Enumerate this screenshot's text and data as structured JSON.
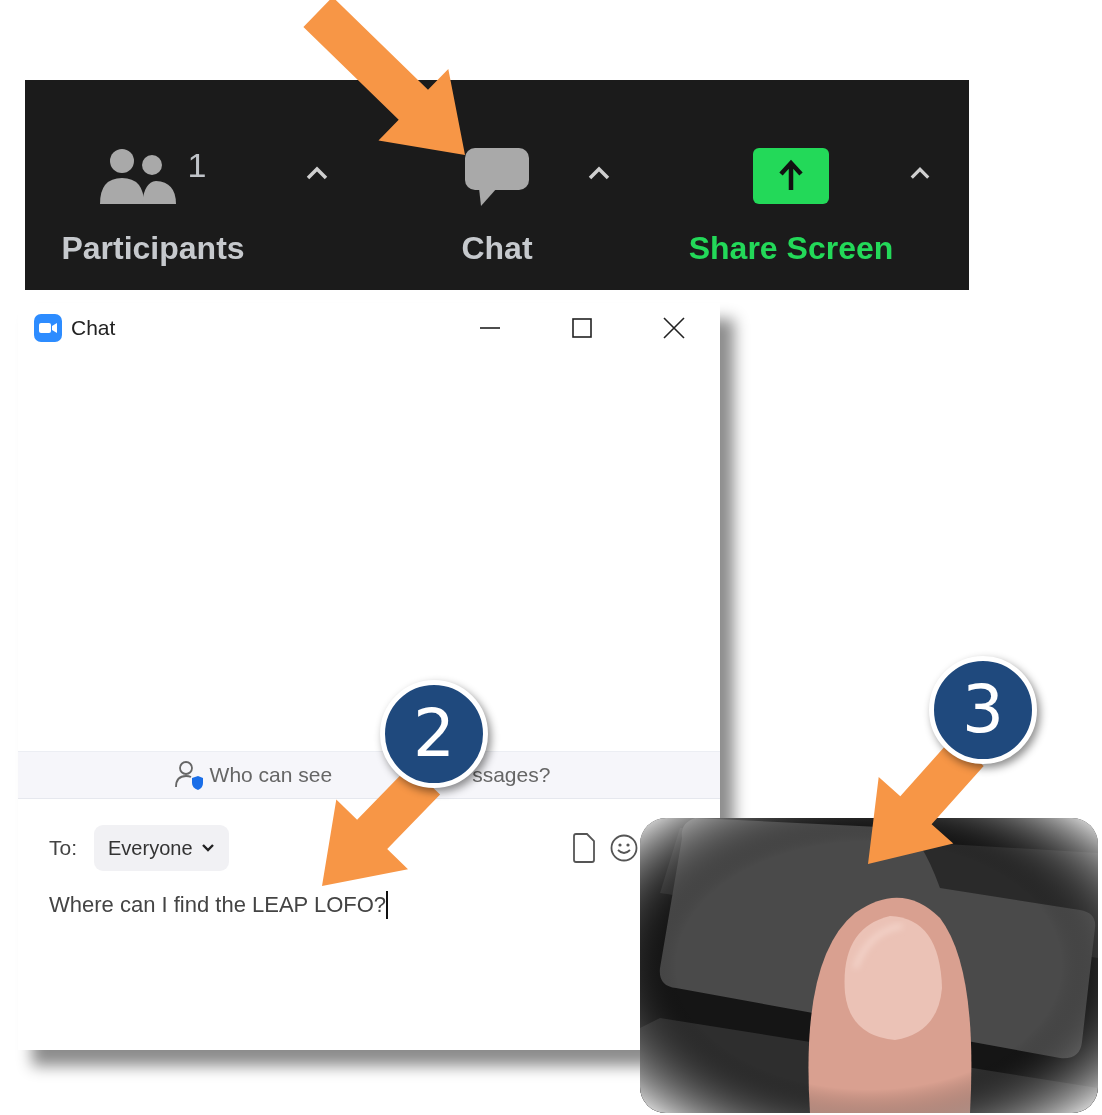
{
  "toolbar": {
    "buttons": [
      {
        "kind": "participants",
        "label": "Participants",
        "count": "1"
      },
      {
        "kind": "chat",
        "label": "Chat"
      },
      {
        "kind": "share",
        "label": "Share Screen"
      }
    ]
  },
  "chat_window": {
    "title": "Chat",
    "notice": [
      "Who can see",
      "ssages?"
    ],
    "to_label": "To:",
    "recipient": "Everyone",
    "message": "Where can I find the LEAP LOFO?"
  },
  "steps": [
    {
      "number": "2"
    },
    {
      "number": "3"
    }
  ]
}
